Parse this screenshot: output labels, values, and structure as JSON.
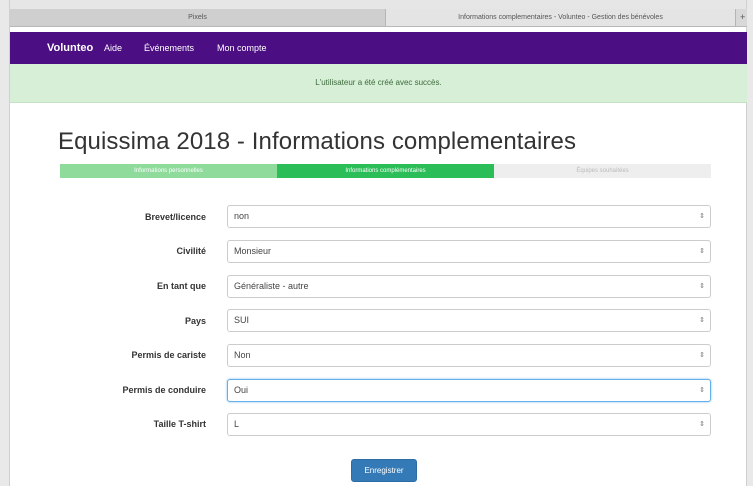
{
  "browser": {
    "tabs": [
      {
        "label": "Pixels"
      },
      {
        "label": "Informations complementaires - Volunteo - Gestion des bénévoles"
      }
    ],
    "new_tab": "+"
  },
  "nav": {
    "brand": "Volunteo",
    "links": [
      "Aide",
      "Événements",
      "Mon compte"
    ],
    "background": "#4b0f83"
  },
  "alert": {
    "message": "L'utilisateur a été créé avec succès."
  },
  "page": {
    "title": "Equissima 2018 - Informations complementaires"
  },
  "progress": {
    "steps": [
      {
        "label": "Informations personnelles",
        "state": "done"
      },
      {
        "label": "Informations complémentaires",
        "state": "active"
      },
      {
        "label": "Équipes souhaitées",
        "state": "pending"
      }
    ]
  },
  "form": {
    "fields": [
      {
        "label": "Brevet/licence",
        "value": "non"
      },
      {
        "label": "Civilité",
        "value": "Monsieur"
      },
      {
        "label": "En tant que",
        "value": "Généraliste - autre"
      },
      {
        "label": "Pays",
        "value": "SUI"
      },
      {
        "label": "Permis de cariste",
        "value": "Non"
      },
      {
        "label": "Permis de conduire",
        "value": "Oui"
      },
      {
        "label": "Taille T-shirt",
        "value": "L"
      }
    ],
    "submit_label": "Enregistrer",
    "select_arrows": "⇕"
  }
}
